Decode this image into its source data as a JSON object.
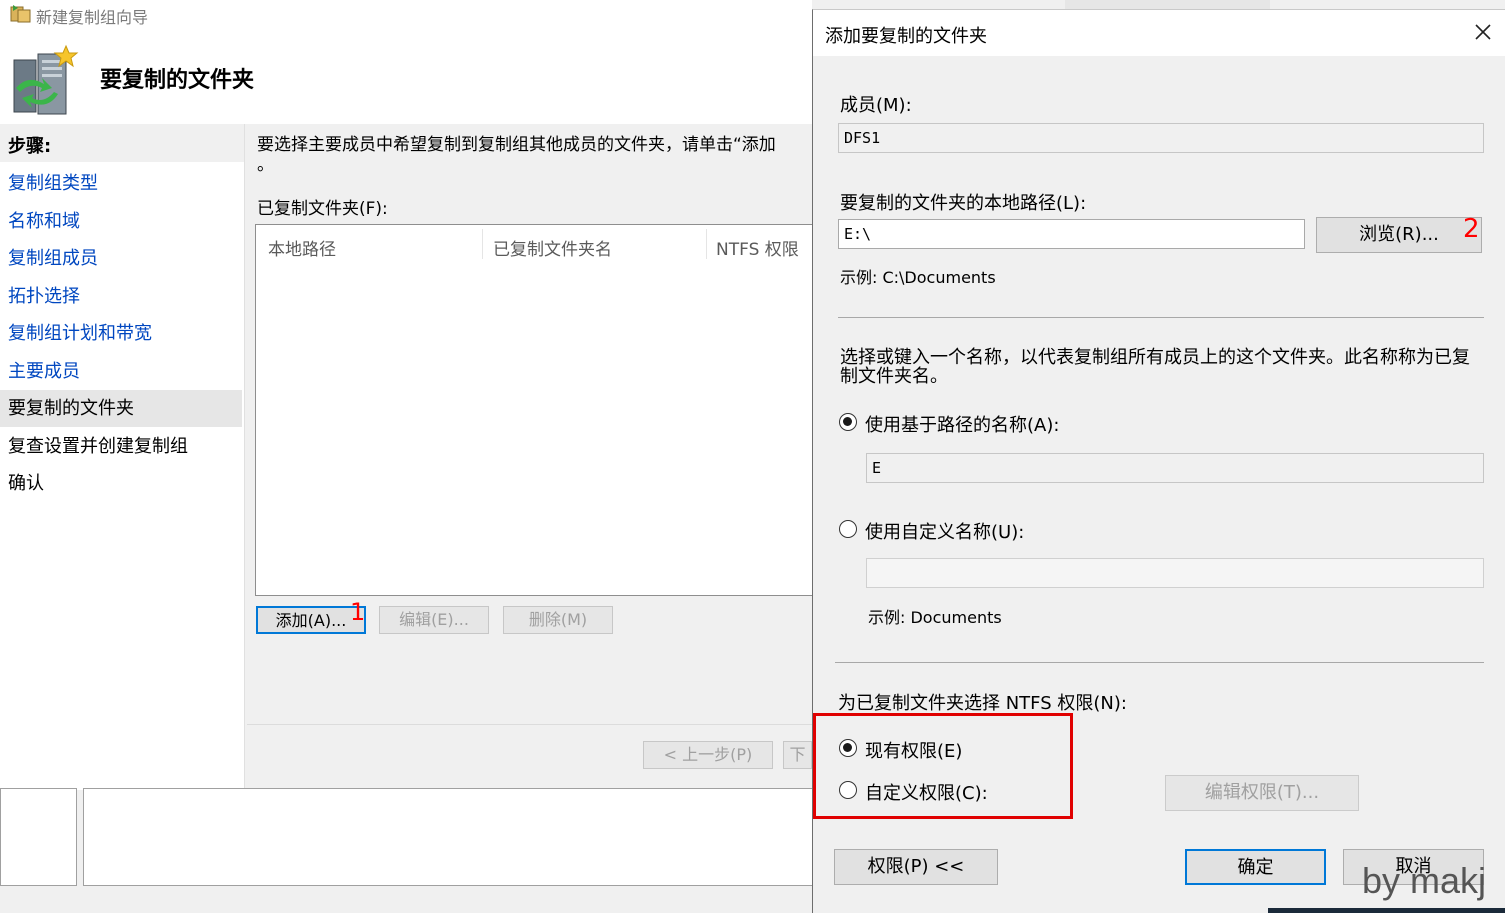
{
  "wizard": {
    "window_title": "新建复制组向导",
    "header_title": "要复制的文件夹",
    "steps_heading": "步骤:",
    "steps": [
      {
        "label": "复制组类型",
        "state": "link"
      },
      {
        "label": "名称和域",
        "state": "link"
      },
      {
        "label": "复制组成员",
        "state": "link"
      },
      {
        "label": "拓扑选择",
        "state": "link"
      },
      {
        "label": "复制组计划和带宽",
        "state": "link"
      },
      {
        "label": "主要成员",
        "state": "link"
      },
      {
        "label": "要复制的文件夹",
        "state": "current"
      },
      {
        "label": "复查设置并创建复制组",
        "state": "plain"
      },
      {
        "label": "确认",
        "state": "plain"
      }
    ],
    "description": "要选择主要成员中希望复制到复制组其他成员的文件夹，请单击“添加",
    "description_tail": "。",
    "replicated_label": "已复制文件夹(F):",
    "columns": [
      "本地路径",
      "已复制文件夹名",
      "NTFS 权限"
    ],
    "buttons": {
      "add": "添加(A)...",
      "edit": "编辑(E)...",
      "delete": "删除(M)",
      "back": "< 上一步(P)",
      "next_stub": "下"
    },
    "marker": "1"
  },
  "dialog": {
    "title": "添加要复制的文件夹",
    "member_label": "成员(M):",
    "member_value": "DFS1",
    "local_path_label": "要复制的文件夹的本地路径(L):",
    "local_path_value": "E:\\",
    "browse_button": "浏览(R)...",
    "browse_marker": "2",
    "path_example": "示例: C:\\Documents",
    "name_description_line1": "选择或键入一个名称，以代表复制组所有成员上的这个文件夹。此名称称为已复",
    "name_description_line2": "制文件夹名。",
    "radio_path_name": "使用基于路径的名称(A):",
    "path_name_value": "E",
    "radio_custom_name": "使用自定义名称(U):",
    "custom_name_value": "",
    "custom_example": "示例: Documents",
    "ntfs_label": "为已复制文件夹选择 NTFS 权限(N):",
    "radio_existing_perm": "现有权限(E)",
    "radio_custom_perm": "自定义权限(C):",
    "edit_perm_button": "编辑权限(T)...",
    "perm_button": "权限(P) <<",
    "ok_button": "确定",
    "cancel_button": "取消"
  },
  "watermark": "by makj",
  "colors": {
    "accent": "#0078d7",
    "link": "#0047c0",
    "annotation_red": "#e00000"
  }
}
